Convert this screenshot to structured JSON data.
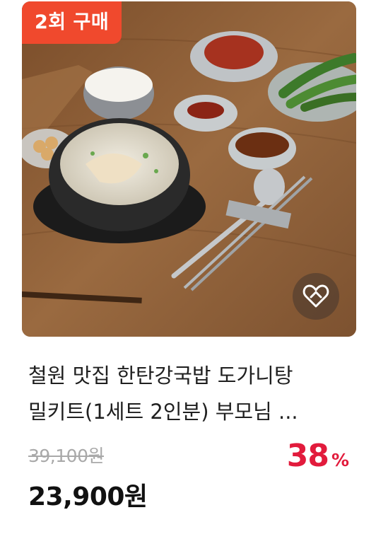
{
  "badge": {
    "label": "2회 구매"
  },
  "product": {
    "title_line1": "철원 맛집 한탄강국밥 도가니탕",
    "title_line2": "밀키트(1세트 2인분) 부모님 ...",
    "original_price": "39,100원",
    "discount_rate": "38",
    "discount_unit": "%",
    "sale_price": "23,900원"
  },
  "image": {
    "alt_icon": "food-photo",
    "wish_icon": "heart-wishlist-icon"
  },
  "colors": {
    "badge_bg": "#f0492d",
    "discount": "#e21b3c",
    "table_wood": "#8a5a33"
  }
}
